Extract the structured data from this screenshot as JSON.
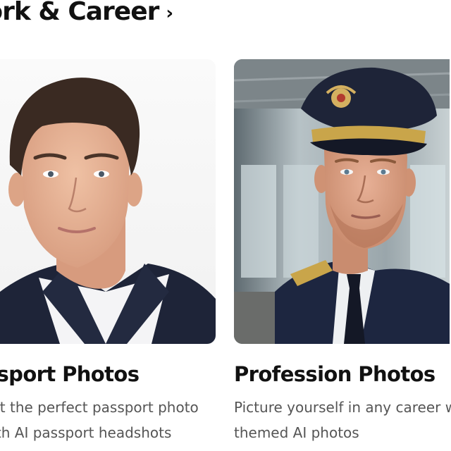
{
  "section": {
    "title": "Work & Career"
  },
  "cards": [
    {
      "title": "Passport Photos",
      "description_line1": "Get the perfect passport photo",
      "description_line2": "with AI passport headshots",
      "image_alt": "Man in navy blazer and white shirt against white background"
    },
    {
      "title": "Profession Photos",
      "description_line1": "Picture yourself in any career with",
      "description_line2": "themed AI photos",
      "image_alt": "Man in pilot uniform and cap in an airport terminal"
    }
  ],
  "icons": {
    "section_chevron": "chevron-right-icon"
  }
}
